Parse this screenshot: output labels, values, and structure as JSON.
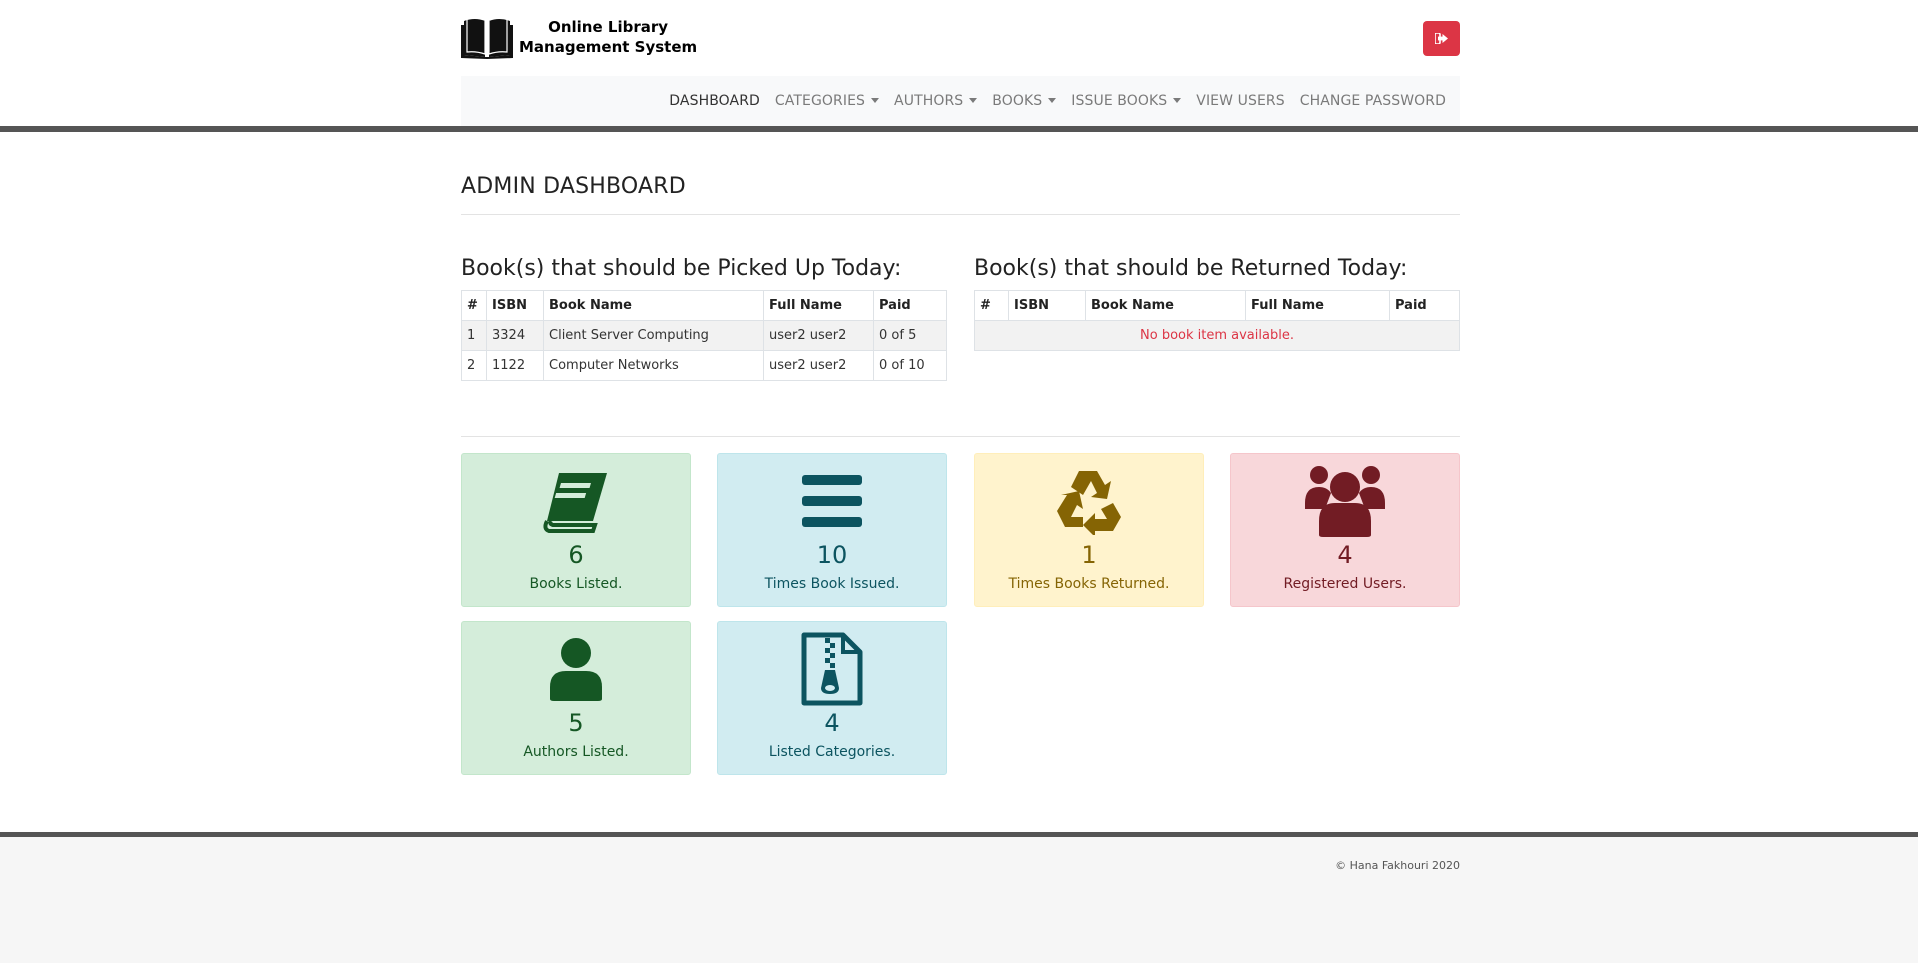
{
  "header": {
    "brand_line1": "Online Library",
    "brand_line2": "Management System",
    "logout_icon": "sign-out-icon",
    "logout_color": "#dc3545"
  },
  "nav": {
    "dashboard": "DASHBOARD",
    "categories": "CATEGORIES",
    "authors": "AUTHORS",
    "books": "BOOKS",
    "issue_books": "ISSUE BOOKS",
    "view_users": "VIEW USERS",
    "change_password": "CHANGE PASSWORD"
  },
  "page_title": "ADMIN DASHBOARD",
  "pickup": {
    "title": "Book(s) that should be Picked Up Today:",
    "headers": [
      "#",
      "ISBN",
      "Book Name",
      "Full Name",
      "Paid"
    ],
    "rows": [
      [
        "1",
        "3324",
        "Client Server Computing",
        "user2 user2",
        "0 of 5"
      ],
      [
        "2",
        "1122",
        "Computer Networks",
        "user2 user2",
        "0 of 10"
      ]
    ]
  },
  "returned": {
    "title": "Book(s) that should be Returned Today:",
    "headers": [
      "#",
      "ISBN",
      "Book Name",
      "Full Name",
      "Paid"
    ],
    "empty_message": "No book item available."
  },
  "stats": [
    {
      "count": "6",
      "label": "Books Listed.",
      "icon": "book-icon",
      "color": "#155724"
    },
    {
      "count": "10",
      "label": "Times Book Issued.",
      "icon": "list-icon",
      "color": "#0c5460"
    },
    {
      "count": "1",
      "label": "Times Books Returned.",
      "icon": "recycle-icon",
      "color": "#856404"
    },
    {
      "count": "4",
      "label": "Registered Users.",
      "icon": "users-icon",
      "color": "#721c24"
    },
    {
      "count": "5",
      "label": "Authors Listed.",
      "icon": "user-icon",
      "color": "#155724"
    },
    {
      "count": "4",
      "label": "Listed Categories.",
      "icon": "file-archive-icon",
      "color": "#0c5460"
    }
  ],
  "footer": {
    "copyright": "© Hana Fakhouri 2020"
  }
}
